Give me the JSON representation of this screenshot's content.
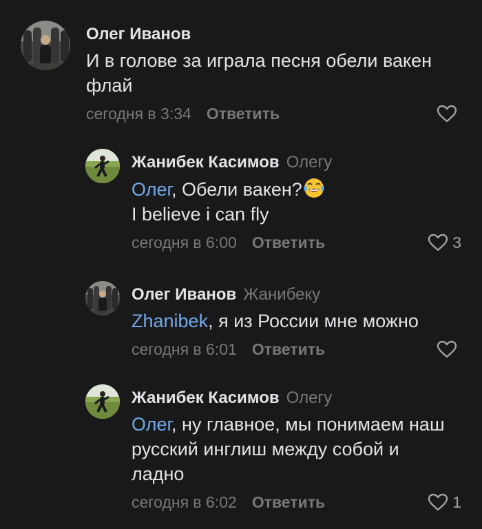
{
  "comments": [
    {
      "author": "Олег Иванов",
      "reply_to": "",
      "mention": "",
      "text_parts": [
        "И в голове за играла песня обели вакен флай"
      ],
      "time": "сегодня в 3:34",
      "reply_label": "Ответить",
      "likes": "",
      "avatar_icon": "avatar-photo-group"
    },
    {
      "author": "Жанибек Касимов",
      "reply_to": "Олегу",
      "mention": "Олег",
      "text_parts": [
        ", Обели вакен?",
        "I believe i can fly"
      ],
      "emoji": "tears-of-joy-emoji",
      "time": "сегодня в 6:00",
      "reply_label": "Ответить",
      "likes": "3",
      "avatar_icon": "avatar-photo-outdoor"
    },
    {
      "author": "Олег Иванов",
      "reply_to": "Жанибеку",
      "mention": "Zhanibek",
      "text_parts": [
        ", я из России мне можно"
      ],
      "time": "сегодня в 6:01",
      "reply_label": "Ответить",
      "likes": "",
      "avatar_icon": "avatar-photo-group"
    },
    {
      "author": "Жанибек Касимов",
      "reply_to": "Олегу",
      "mention": "Олег",
      "text_parts": [
        ", ну главное, мы понимаем наш русский инглиш между собой и ладно"
      ],
      "time": "сегодня в 6:02",
      "reply_label": "Ответить",
      "likes": "1",
      "avatar_icon": "avatar-photo-outdoor"
    }
  ],
  "colors": {
    "background": "#19191a",
    "text": "#e1e3e6",
    "secondary": "#76787a",
    "mention": "#71aaeb"
  }
}
